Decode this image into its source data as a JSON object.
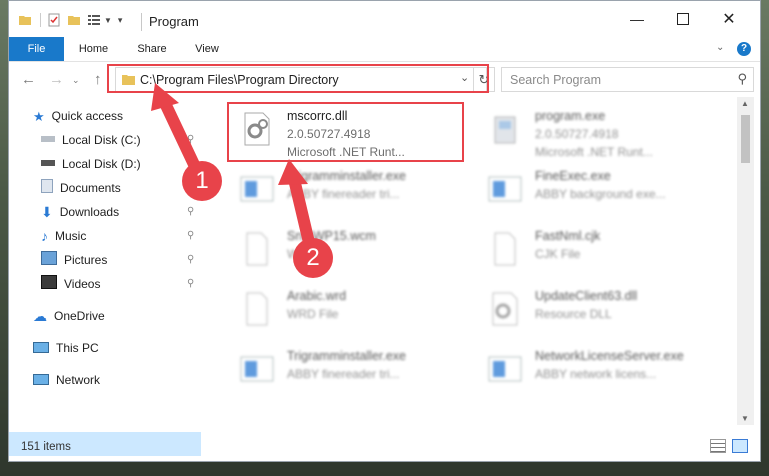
{
  "window": {
    "title": "Program"
  },
  "ribbon": {
    "tabs": [
      "File",
      "Home",
      "Share",
      "View"
    ],
    "help": "?"
  },
  "address": {
    "path": "C:\\Program Files\\Program Directory"
  },
  "search": {
    "placeholder": "Search Program"
  },
  "nav": {
    "items": [
      {
        "label": "Quick access",
        "icon": "star-icon"
      },
      {
        "label": "Local Disk (C:)",
        "icon": "drive-icon"
      },
      {
        "label": "Local Disk (D:)",
        "icon": "drive-icon"
      },
      {
        "label": "Documents",
        "icon": "documents-icon"
      },
      {
        "label": "Downloads",
        "icon": "download-icon"
      },
      {
        "label": "Music",
        "icon": "music-icon"
      },
      {
        "label": "Pictures",
        "icon": "pictures-icon"
      },
      {
        "label": "Videos",
        "icon": "videos-icon"
      },
      {
        "label": "OneDrive",
        "icon": "cloud-icon"
      },
      {
        "label": "This PC",
        "icon": "computer-icon"
      },
      {
        "label": "Network",
        "icon": "network-icon"
      }
    ]
  },
  "files": [
    {
      "name": "mscorrc.dll",
      "line1": "2.0.50727.4918",
      "line2": "Microsoft .NET Runt...",
      "icon": "dll-gear-icon"
    },
    {
      "name": "program.exe",
      "line1": "2.0.50727.4918",
      "line2": "Microsoft .NET Runt...",
      "icon": "exe-icon"
    },
    {
      "name": "Trigramminstaller.exe",
      "line1": "ABBY finereader tri...",
      "line2": "",
      "icon": "window-icon"
    },
    {
      "name": "FineExec.exe",
      "line1": "ABBY background exe...",
      "line2": "",
      "icon": "window-icon"
    },
    {
      "name": "Sn...WP15.wcm",
      "line1": "W...",
      "line2": "",
      "icon": "file-icon"
    },
    {
      "name": "FastNml.cjk",
      "line1": "CJK File",
      "line2": "",
      "icon": "file-icon"
    },
    {
      "name": "Arabic.wrd",
      "line1": "WRD File",
      "line2": "",
      "icon": "file-icon"
    },
    {
      "name": "UpdateClient63.dll",
      "line1": "Resource DLL",
      "line2": "",
      "icon": "dll-gear-icon"
    },
    {
      "name": "Trigramminstaller.exe",
      "line1": "ABBY finereader tri...",
      "line2": "",
      "icon": "window-icon"
    },
    {
      "name": "NetworkLicenseServer.exe",
      "line1": "ABBY network licens...",
      "line2": "",
      "icon": "window-icon"
    }
  ],
  "status": {
    "count": "151 items"
  },
  "annotations": {
    "step1": "1",
    "step2": "2",
    "color": "#e8434a"
  }
}
